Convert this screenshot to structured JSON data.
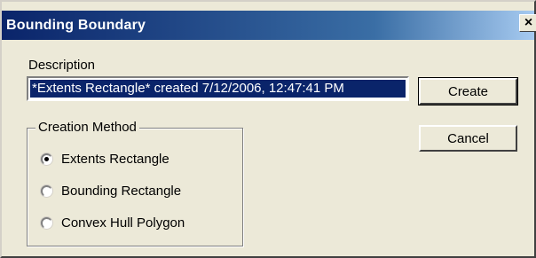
{
  "window": {
    "title": "Bounding Boundary",
    "close_glyph": "×"
  },
  "description": {
    "label": "Description",
    "value": "*Extents Rectangle* created 7/12/2006, 12:47:41 PM"
  },
  "buttons": {
    "create_label": "Create",
    "cancel_label": "Cancel"
  },
  "creation_method": {
    "legend": "Creation Method",
    "options": [
      {
        "label": "Extents Rectangle",
        "selected": true
      },
      {
        "label": "Bounding Rectangle",
        "selected": false
      },
      {
        "label": "Convex Hull Polygon",
        "selected": false
      }
    ]
  },
  "colors": {
    "titlebar_start": "#0a246a",
    "titlebar_end": "#a6caf0",
    "dialog_face": "#ece9d8",
    "selection_bg": "#0a246a"
  }
}
